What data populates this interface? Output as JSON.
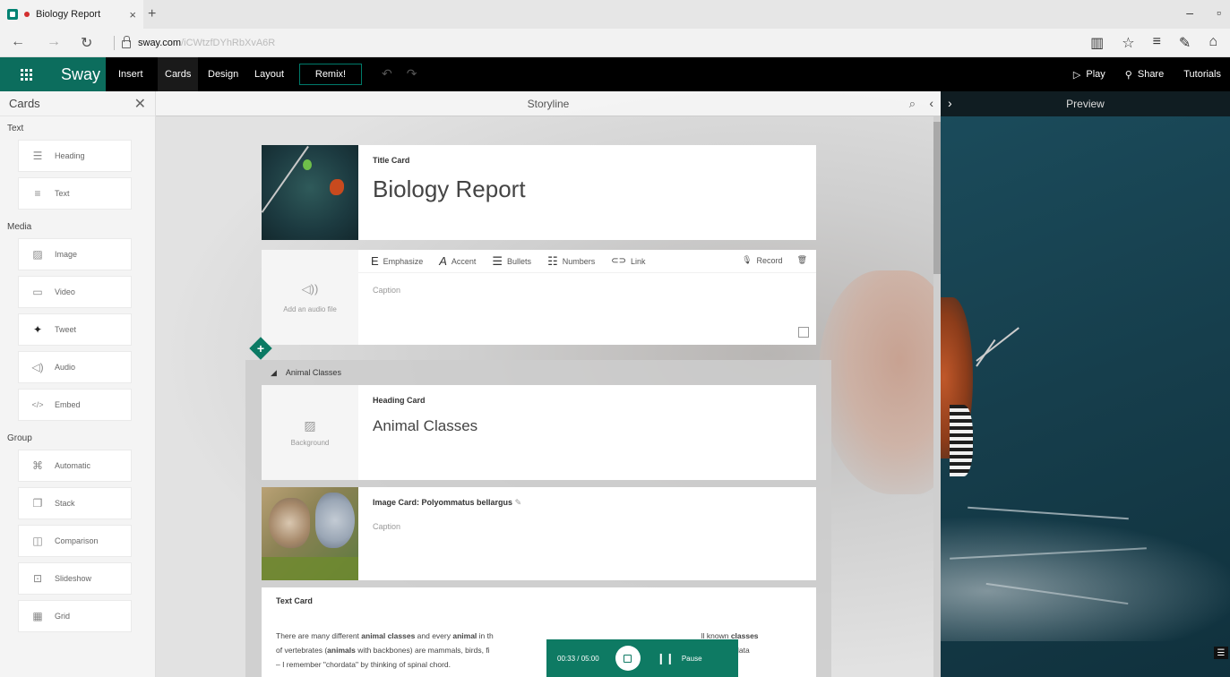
{
  "browser": {
    "tab_title": "Biology Report",
    "tab_close": "×",
    "new_tab": "+",
    "url_host": "sway.com",
    "url_path": "/iCWtzfDYhRbXvA6R",
    "win_minimize": "–",
    "win_restore": "▫",
    "back": "←",
    "forward": "→",
    "refresh": "↻"
  },
  "app": {
    "brand": "Sway",
    "menu": [
      "Insert",
      "Cards",
      "Design",
      "Layout"
    ],
    "remix_label": "Remix!",
    "play_label": "Play",
    "share_label": "Share",
    "tutorials_label": "Tutorials"
  },
  "cards_panel": {
    "title": "Cards",
    "sections": [
      {
        "label": "Text",
        "items": [
          {
            "label": "Heading",
            "icon": "heading-icon"
          },
          {
            "label": "Text",
            "icon": "text-icon"
          }
        ]
      },
      {
        "label": "Media",
        "items": [
          {
            "label": "Image",
            "icon": "image-icon"
          },
          {
            "label": "Video",
            "icon": "video-icon"
          },
          {
            "label": "Tweet",
            "icon": "twitter-icon"
          },
          {
            "label": "Audio",
            "icon": "audio-icon"
          },
          {
            "label": "Embed",
            "icon": "embed-icon"
          }
        ]
      },
      {
        "label": "Group",
        "items": [
          {
            "label": "Automatic",
            "icon": "automatic-icon"
          },
          {
            "label": "Stack",
            "icon": "stack-icon"
          },
          {
            "label": "Comparison",
            "icon": "comparison-icon"
          },
          {
            "label": "Slideshow",
            "icon": "slideshow-icon"
          },
          {
            "label": "Grid",
            "icon": "grid-icon"
          }
        ]
      }
    ]
  },
  "storyline": {
    "header": "Storyline",
    "title_card": {
      "type": "Title Card",
      "title": "Biology Report"
    },
    "toolbar": {
      "emphasize": "Emphasize",
      "accent": "Accent",
      "bullets": "Bullets",
      "numbers": "Numbers",
      "link": "Link",
      "record": "Record"
    },
    "audio_placeholder": "Add an audio file",
    "caption_placeholder": "Caption",
    "group": {
      "label": "Animal Classes",
      "heading_card": {
        "type": "Heading Card",
        "title": "Animal Classes",
        "background_label": "Background"
      },
      "image_card": {
        "type": "Image Card: Polyommatus bellargus",
        "caption": "Caption"
      },
      "text_card": {
        "type": "Text Card",
        "line1_a": "There are many different ",
        "line1_b": "animal classes",
        "line1_c": " and every ",
        "line1_d": "animal",
        "line1_e": " in th",
        "line1_f": "ll known ",
        "line1_g": "classes",
        "line2_a": "of vertebrates (",
        "line2_b": "animals",
        "line2_c": " with backbones) are mammals, birds, fi",
        "line2_d": "hylum chordata",
        "line3": "– I remember \"chordata\" by thinking of spinal chord."
      }
    }
  },
  "recorder": {
    "time": "00:33 / 05:00",
    "pause_label": "Pause"
  },
  "preview": {
    "header": "Preview"
  },
  "colors": {
    "accent": "#0c6d5d",
    "toolbar": "#000000",
    "recorder": "#0e7a63"
  }
}
